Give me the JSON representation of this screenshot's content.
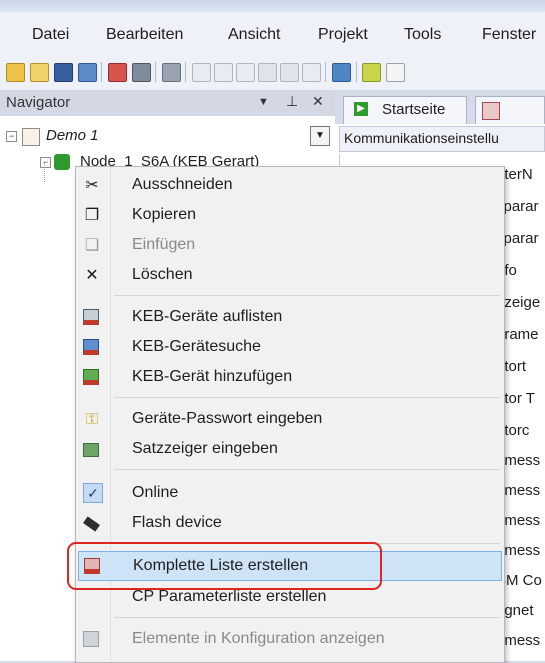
{
  "menubar": {
    "items": [
      "Datei",
      "Bearbeiten",
      "Ansicht",
      "Projekt",
      "Tools",
      "Fenster"
    ]
  },
  "navigator": {
    "title": "Navigator",
    "pin": "↓",
    "dock": "⩢",
    "close": "✕",
    "project": "Demo 1",
    "node": "Node_1_S6A (KEB Gerart)"
  },
  "tabs": {
    "start": "Startseite"
  },
  "subbar": {
    "label": "Kommunikationseinstellu"
  },
  "right_list": [
    "eterN",
    "sparar",
    "sparar",
    "nfo",
    "nzeige",
    "arame",
    "otort",
    "otor T",
    "otorc",
    "emess",
    "emess",
    "emess",
    "emess",
    "SM Co",
    "agnet",
    "emess"
  ],
  "context_menu": {
    "items": [
      {
        "label": "Ausschneiden",
        "icon": "scissors-icon",
        "glyph": "✂"
      },
      {
        "label": "Kopieren",
        "icon": "copy-icon",
        "glyph": "❐"
      },
      {
        "label": "Einfügen",
        "icon": "paste-icon",
        "glyph": "❑"
      },
      {
        "label": "Löschen",
        "icon": "delete-icon",
        "glyph": "✕"
      },
      {
        "label": "KEB-Geräte auflisten",
        "icon": "keb-list-icon"
      },
      {
        "label": "KEB-Gerätesuche",
        "icon": "keb-search-icon"
      },
      {
        "label": "KEB-Gerät hinzufügen",
        "icon": "keb-add-icon"
      },
      {
        "label": "Geräte-Passwort eingeben",
        "icon": "key-icon",
        "glyph": "⚿"
      },
      {
        "label": "Satzzeiger eingeben",
        "icon": "pointer-icon"
      },
      {
        "label": "Online",
        "icon": "checkmark-icon",
        "glyph": "✓"
      },
      {
        "label": "Flash device",
        "icon": "chip-icon"
      },
      {
        "label": "Komplette Liste erstellen",
        "icon": "keb-list-full-icon"
      },
      {
        "label": "CP Parameterliste erstellen",
        "icon": "none"
      },
      {
        "label": "Elemente in Konfiguration anzeigen",
        "icon": "config-icon"
      }
    ]
  },
  "colors": {
    "accent": "#cfe3f7",
    "highlight_border": "#e02424"
  }
}
